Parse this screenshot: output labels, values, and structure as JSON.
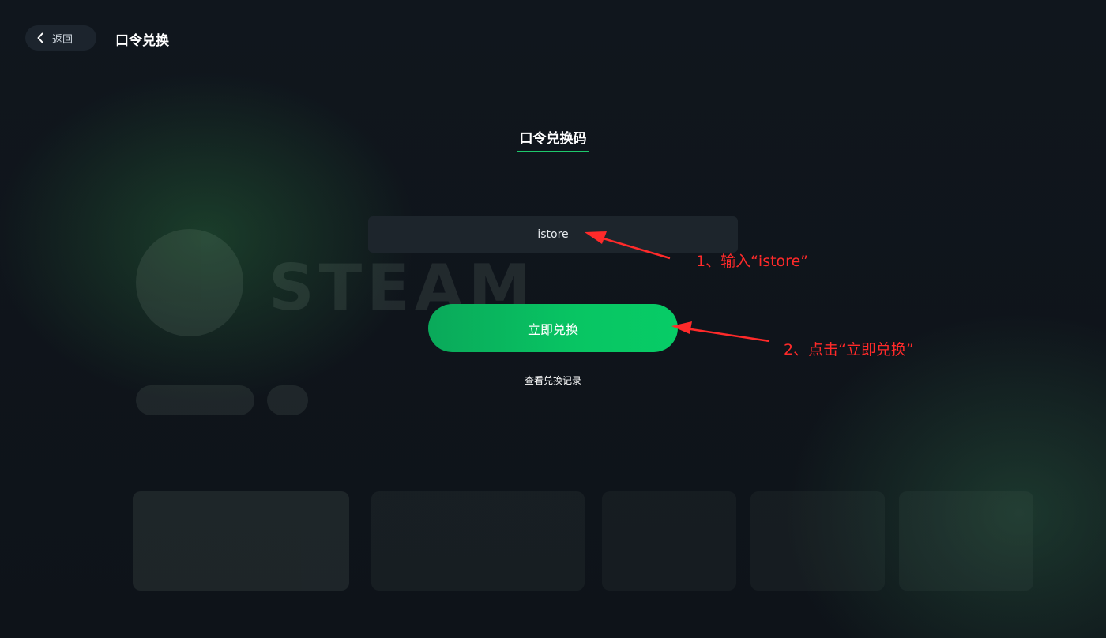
{
  "header": {
    "back_label": "返回",
    "title": "口令兑换"
  },
  "form": {
    "section_title": "口令兑换码",
    "input_value": "istore",
    "redeem_label": "立即兑换",
    "history_link": "查看兑换记录"
  },
  "annotations": [
    {
      "text": "1、输入“istore”"
    },
    {
      "text": "2、点击“立即兑换”"
    }
  ],
  "background": {
    "faded_brand": "STEAM"
  },
  "colors": {
    "accent_green": "#08c563",
    "annotation_red": "#ff2a2a",
    "panel_bg": "#1d252c"
  },
  "icons": {
    "back": "chevron-left-icon",
    "arrow": "arrow-pointer-icon"
  }
}
